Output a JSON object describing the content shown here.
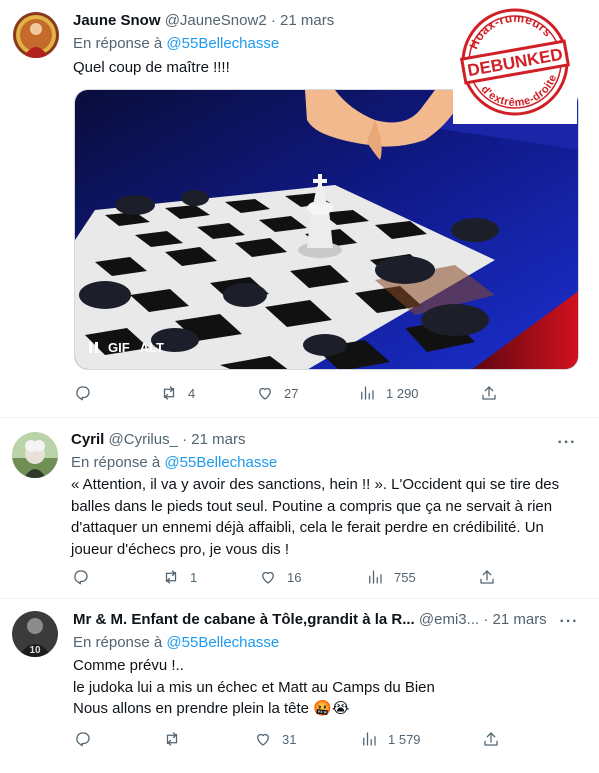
{
  "tweets": [
    {
      "name": "Jaune Snow",
      "handle": "@JauneSnow2",
      "separator": "·",
      "date": "21 mars",
      "reply_prefix": "En réponse à",
      "reply_mention": "@55Bellechasse",
      "lines": [
        "Quel coup de maître !!!!"
      ],
      "media": {
        "gif_label": "GIF",
        "alt_label": "ALT"
      },
      "actions": {
        "reply": "",
        "retweet": "4",
        "like": "27",
        "views": "1 290"
      }
    },
    {
      "name": "Cyril",
      "handle": "@Cyrilus_",
      "separator": "·",
      "date": "21 mars",
      "reply_prefix": "En réponse à",
      "reply_mention": "@55Bellechasse",
      "lines": [
        "« Attention, il va y avoir des sanctions, hein !! ». L'Occident qui se tire des",
        "balles dans le pieds tout seul. Poutine a compris que ça ne servait à rien",
        "d'attaquer un ennemi déjà affaibli, cela le ferait perdre en crédibilité. Un",
        "joueur d'échecs pro, je vous dis !"
      ],
      "actions": {
        "reply": "",
        "retweet": "1",
        "like": "16",
        "views": "755"
      }
    },
    {
      "name": "Mr & M. Enfant de cabane à Tôle,grandit à la R...",
      "handle": "@emi3...",
      "separator": "·",
      "date": "21 mars",
      "reply_prefix": "En réponse à",
      "reply_mention": "@55Bellechasse",
      "lines": [
        "Comme prévu !..",
        "le judoka lui a mis un échec et Matt au Camps du Bien",
        "Nous allons en prendre plein la tête 🤬😭"
      ],
      "actions": {
        "reply": "",
        "retweet": "",
        "like": "31",
        "views": "1 579"
      }
    }
  ],
  "more_label": "···",
  "stamp": {
    "top_text": "Hoax-rumeurs",
    "center_text": "DEBUNKED",
    "bottom_text": "d'extrême-droite"
  },
  "colors": {
    "accent": "#1d9bf0",
    "muted": "#536471",
    "stamp_red": "#d11f26"
  },
  "icons": {
    "reply": "reply-icon",
    "retweet": "retweet-icon",
    "like": "heart-icon",
    "views": "views-icon",
    "share": "share-icon"
  }
}
